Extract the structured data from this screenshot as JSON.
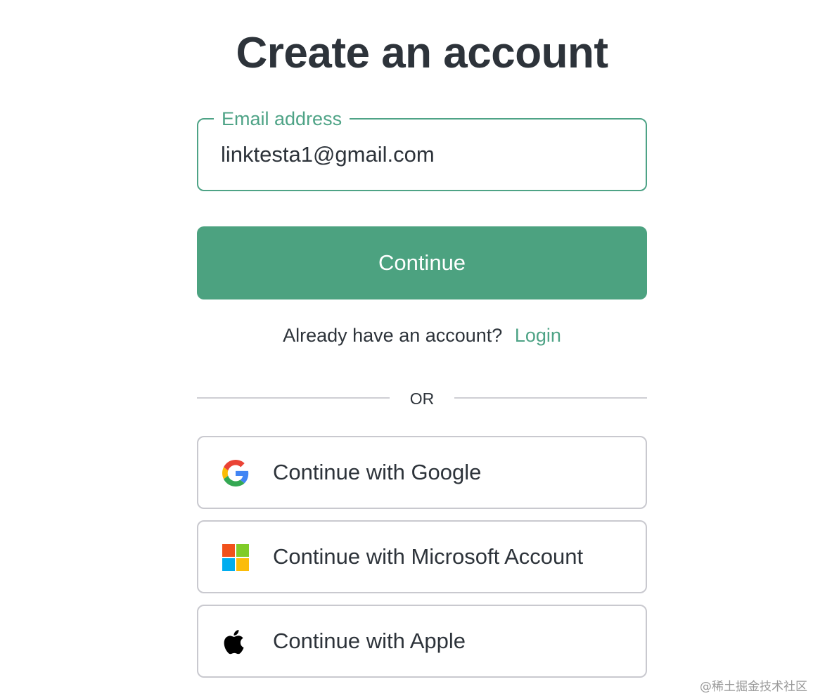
{
  "page": {
    "title": "Create an account"
  },
  "email": {
    "label": "Email address",
    "value": "linktesta1@gmail.com"
  },
  "continue_button": {
    "label": "Continue"
  },
  "login_prompt": {
    "text": "Already have an account?",
    "link": "Login"
  },
  "divider": {
    "text": "OR"
  },
  "social": {
    "google": {
      "label": "Continue with Google",
      "icon": "google-icon"
    },
    "microsoft": {
      "label": "Continue with Microsoft Account",
      "icon": "microsoft-icon"
    },
    "apple": {
      "label": "Continue with Apple",
      "icon": "apple-icon"
    }
  },
  "watermark": {
    "text": "@稀土掘金技术社区"
  },
  "colors": {
    "accent": "#4ca280",
    "text": "#2d333a",
    "border": "#c9c9cf",
    "background": "#ffffff"
  }
}
